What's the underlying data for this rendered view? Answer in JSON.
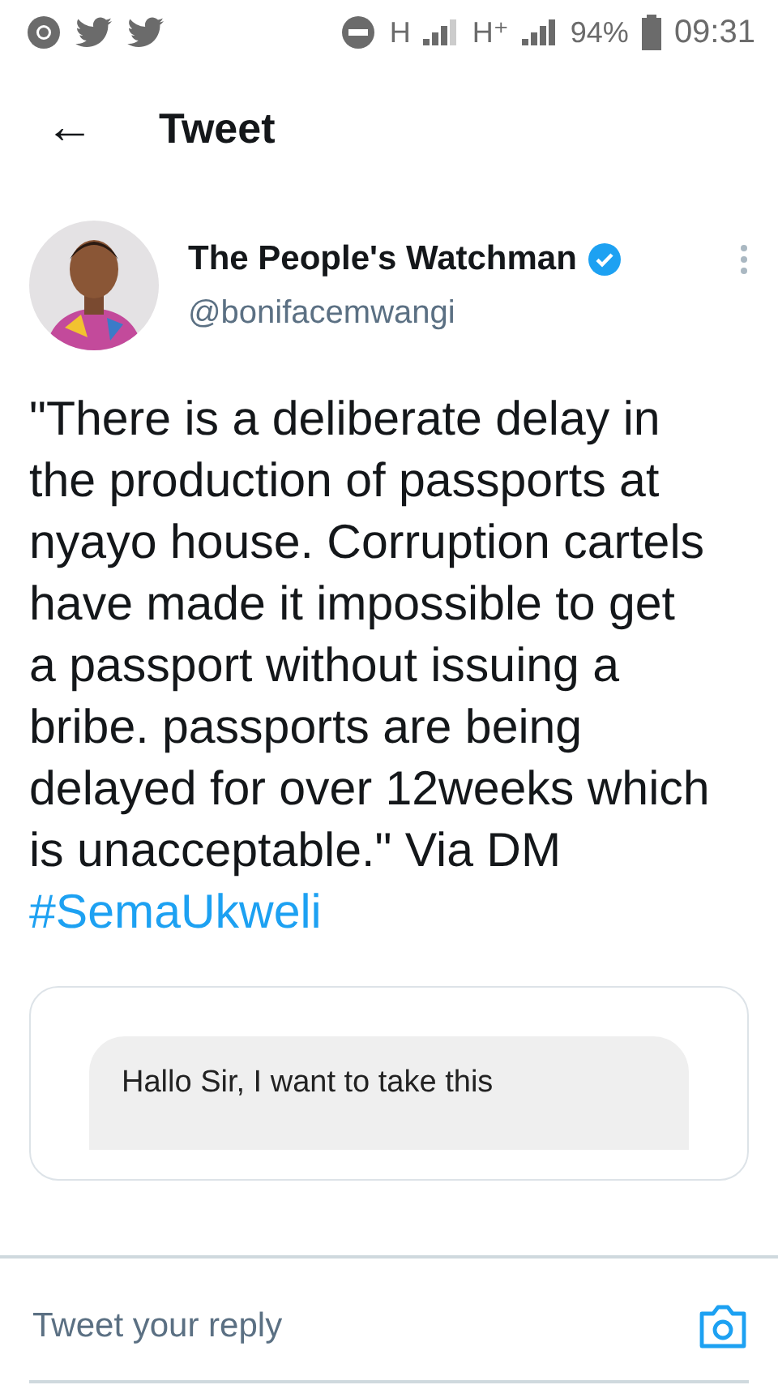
{
  "status_bar": {
    "network_1": "H",
    "network_2": "H⁺",
    "battery": "94%",
    "time": "09:31"
  },
  "header": {
    "back": "←",
    "title": "Tweet"
  },
  "tweet": {
    "author": {
      "name": "The People's Watchman",
      "verified": true,
      "handle": "@bonifacemwangi"
    },
    "text": "\"There is a deliberate delay in the production of passports at nyayo house. Corruption cartels have made it impossible to get a passport without issuing a bribe. passports are being delayed for over 12weeks which is unacceptable.\" Via DM ",
    "hashtag": "#SemaUkweli",
    "attachment": {
      "message": "Hallo Sir, I want to take this"
    }
  },
  "reply": {
    "placeholder": "Tweet your reply"
  }
}
